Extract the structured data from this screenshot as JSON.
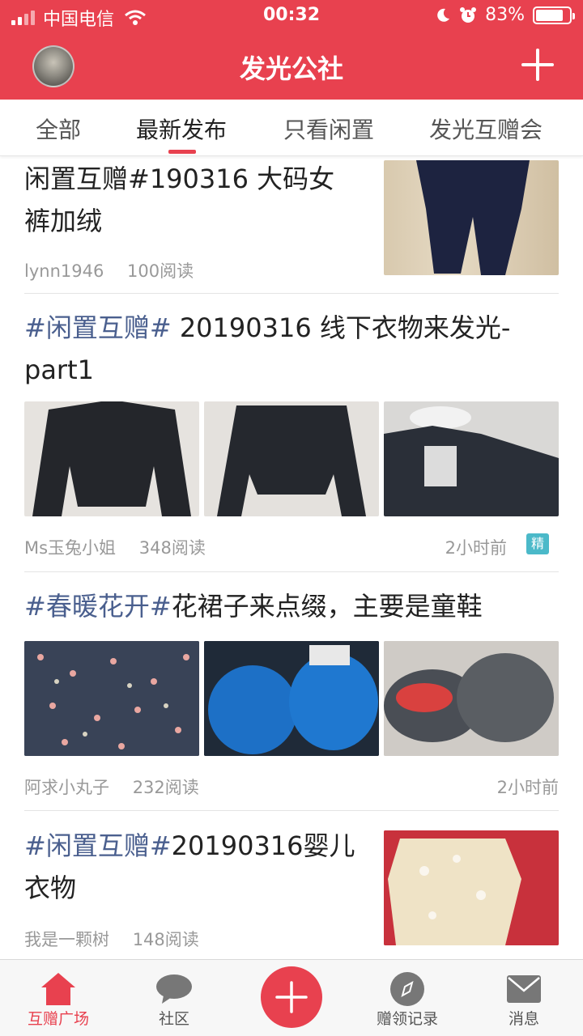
{
  "status": {
    "carrier": "中国电信",
    "time": "00:32",
    "battery": "83%",
    "battery_level": 0.83
  },
  "header": {
    "title": "发光公社"
  },
  "tabs": [
    {
      "label": "全部"
    },
    {
      "label": "最新发布"
    },
    {
      "label": "只看闲置"
    },
    {
      "label": "发光互赠会"
    }
  ],
  "posts": [
    {
      "title_line1": "闲置互赠#190316  大码女",
      "title_line2": "裤加绒",
      "author": "lynn1946",
      "reads": "100阅读"
    },
    {
      "hashtag": "#闲置互赠#",
      "title_rest": " 20190316 线下衣物来发光-",
      "title_line2": "part1",
      "author": "Ms玉兔小姐",
      "reads": "348阅读",
      "time": "2小时前",
      "badge": "精"
    },
    {
      "hashtag": "#春暖花开#",
      "title_rest": "花裙子来点缀，主要是童鞋",
      "author": "阿求小丸子",
      "reads": "232阅读",
      "time": "2小时前"
    },
    {
      "hashtag": "#闲置互赠#",
      "title_rest": "20190316婴儿",
      "title_line2": "衣物",
      "author": "我是一颗树",
      "reads": "148阅读"
    }
  ],
  "bottom_nav": [
    {
      "label": "互赠广场",
      "icon": "home-icon"
    },
    {
      "label": "社区",
      "icon": "chat-bubble-icon"
    },
    {
      "label": "",
      "icon": "plus-icon"
    },
    {
      "label": "赠领记录",
      "icon": "compass-icon"
    },
    {
      "label": "消息",
      "icon": "mail-icon"
    }
  ],
  "colors": {
    "brand": "#e8414f",
    "hashtag": "#4a5f8e",
    "badge": "#4bb9c9"
  }
}
